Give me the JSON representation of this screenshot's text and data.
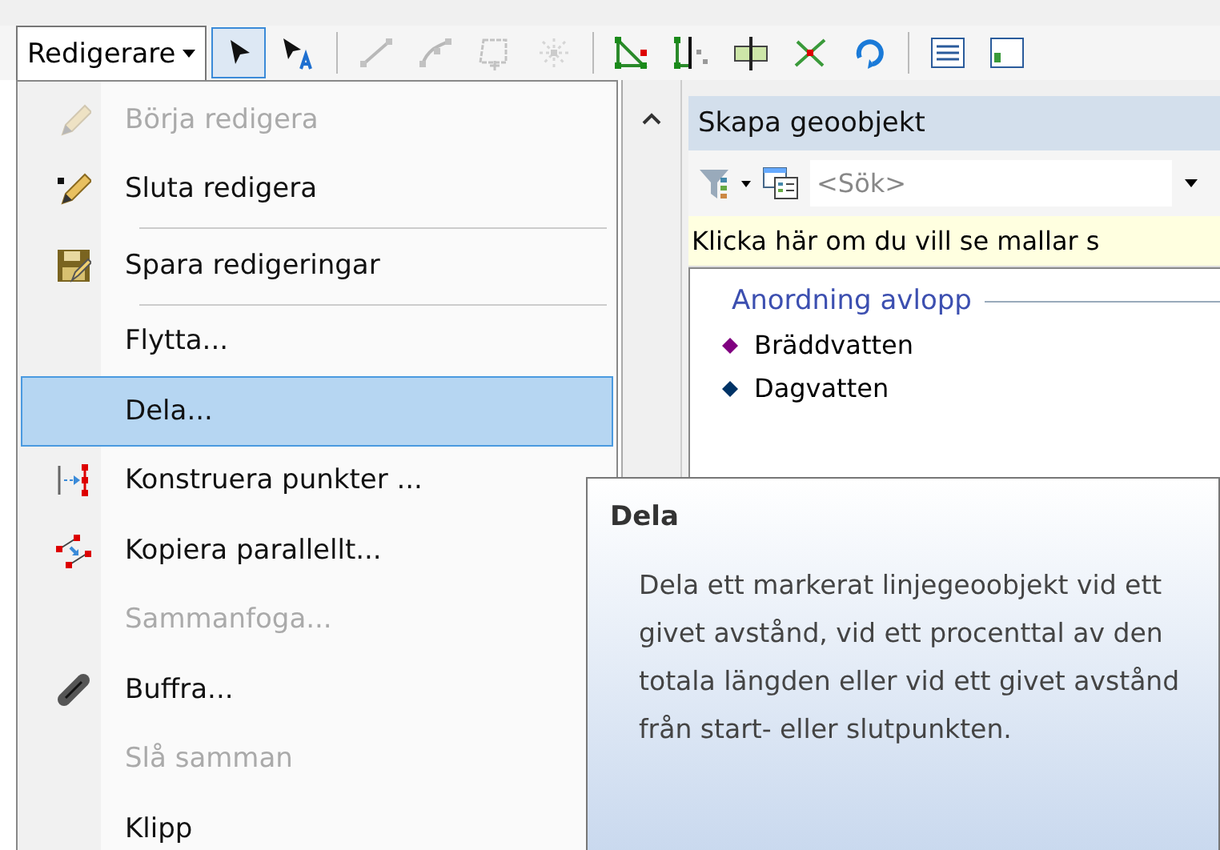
{
  "toolbar": {
    "menu_button": "Redigerare",
    "tools": [
      {
        "kind": "pointer",
        "selected": true,
        "disabled": false
      },
      {
        "kind": "annotation",
        "selected": false,
        "disabled": false
      },
      {
        "kind": "line",
        "selected": false,
        "disabled": true
      },
      {
        "kind": "curve",
        "selected": false,
        "disabled": true
      },
      {
        "kind": "polygon",
        "selected": false,
        "disabled": true
      },
      {
        "kind": "explode",
        "selected": false,
        "disabled": true
      },
      {
        "kind": "vertices",
        "selected": false,
        "disabled": false
      },
      {
        "kind": "split",
        "selected": false,
        "disabled": false
      },
      {
        "kind": "bar",
        "selected": false,
        "disabled": false
      },
      {
        "kind": "intersect",
        "selected": false,
        "disabled": false
      },
      {
        "kind": "rotate",
        "selected": false,
        "disabled": false
      },
      {
        "kind": "table",
        "selected": false,
        "disabled": false
      },
      {
        "kind": "window",
        "selected": false,
        "disabled": false
      }
    ]
  },
  "menu": {
    "items": [
      {
        "kind": "pencil",
        "label": "Börja redigera",
        "disabled": true,
        "selected": false,
        "separator_after": false
      },
      {
        "kind": "pencil",
        "label": "Sluta redigera",
        "disabled": false,
        "selected": false,
        "separator_after": true
      },
      {
        "kind": "save",
        "label": "Spara redigeringar",
        "disabled": false,
        "selected": false,
        "separator_after": true
      },
      {
        "kind": "none",
        "label": "Flytta...",
        "disabled": false,
        "selected": false,
        "separator_after": false
      },
      {
        "kind": "none",
        "label": "Dela...",
        "disabled": false,
        "selected": true,
        "separator_after": false
      },
      {
        "kind": "points",
        "label": "Konstruera punkter ...",
        "disabled": false,
        "selected": false,
        "separator_after": false
      },
      {
        "kind": "parallel",
        "label": "Kopiera parallellt...",
        "disabled": false,
        "selected": false,
        "separator_after": false
      },
      {
        "kind": "none",
        "label": "Sammanfoga...",
        "disabled": true,
        "selected": false,
        "separator_after": false
      },
      {
        "kind": "buffer",
        "label": "Buffra...",
        "disabled": false,
        "selected": false,
        "separator_after": false
      },
      {
        "kind": "none",
        "label": "Slå samman",
        "disabled": true,
        "selected": false,
        "separator_after": false
      },
      {
        "kind": "none",
        "label": "Klipp",
        "disabled": false,
        "selected": false,
        "separator_after": false
      }
    ]
  },
  "panel": {
    "title": "Skapa geoobjekt",
    "search": {
      "placeholder": "<Sök>"
    },
    "notice": "Klicka här om du vill se mallar s",
    "group": "Anordning avlopp",
    "templates": [
      {
        "label": "Bräddvatten",
        "color": "#800080"
      },
      {
        "label": "Dagvatten",
        "color": "#003366"
      }
    ]
  },
  "tooltip": {
    "title": "Dela",
    "text": "Dela ett markerat linjegeoobjekt vid ett givet avstånd, vid ett procenttal av den totala längden eller vid ett givet avstånd från start- eller slutpunkten."
  }
}
